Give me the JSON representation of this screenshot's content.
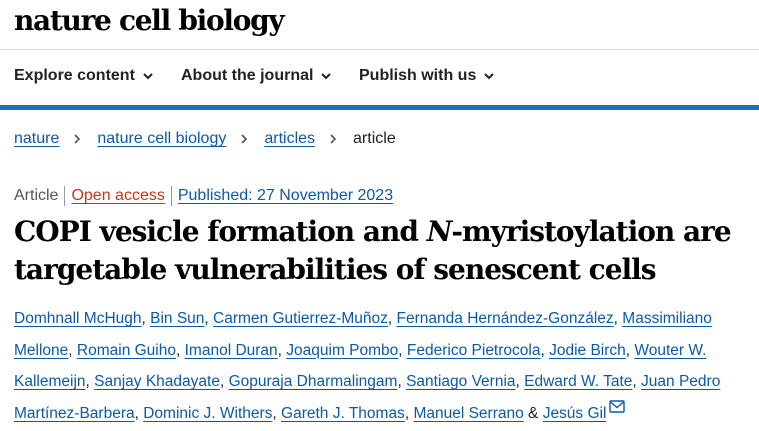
{
  "brand": {
    "logo_text": "nature cell biology"
  },
  "nav": {
    "items": [
      {
        "label": "Explore content",
        "icon": "chevron-down-icon"
      },
      {
        "label": "About the journal",
        "icon": "chevron-down-icon"
      },
      {
        "label": "Publish with us",
        "icon": "chevron-down-icon"
      }
    ],
    "accent_color": "#1a73b8"
  },
  "breadcrumb": {
    "items": [
      "nature",
      "nature cell biology",
      "articles"
    ],
    "current": "article"
  },
  "article": {
    "type": "Article",
    "access": "Open access",
    "published": "Published: 27 November 2023",
    "title_part1": "COPI vesicle formation and ",
    "title_italic": "N",
    "title_part2": "-myristoylation are targetable vulnerabilities of senescent cells",
    "authors": [
      "Domhnall McHugh",
      "Bin Sun",
      "Carmen Gutierrez-Muñoz",
      "Fernanda Hernández-González",
      "Massimiliano Mellone",
      "Romain Guiho",
      "Imanol Duran",
      "Joaquim Pombo",
      "Federico Pietrocola",
      "Jodie Birch",
      "Wouter W. Kallemeijn",
      "Sanjay Khadayate",
      "Gopuraja Dharmalingam",
      "Santiago Vernia",
      "Edward W. Tate",
      "Juan Pedro Martínez-Barbera",
      "Dominic J. Withers",
      "Gareth J. Thomas",
      "Manuel Serrano",
      "Jesús Gil"
    ],
    "author_separator": ", ",
    "final_separator": " & ",
    "corresponding_icon": "mail-icon"
  },
  "colors": {
    "link": "#0b5aa6",
    "open_access": "#c4371b",
    "text": "#222222"
  }
}
